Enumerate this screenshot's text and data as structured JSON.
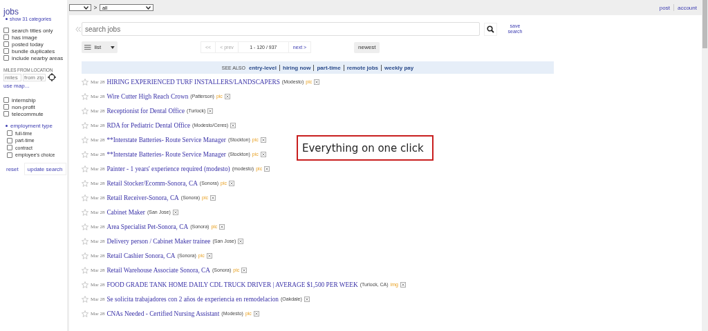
{
  "sidebar": {
    "title": "jobs",
    "show_categories": "show 31 categories",
    "filters": [
      {
        "label": "search titles only",
        "checked": false
      },
      {
        "label": "has image",
        "checked": false
      },
      {
        "label": "posted today",
        "checked": false
      },
      {
        "label": "bundle duplicates",
        "checked": false
      },
      {
        "label": "include nearby areas",
        "checked": false
      }
    ],
    "miles_label": "MILES FROM LOCATION",
    "miles_placeholder": "miles",
    "zip_placeholder": "from zip",
    "use_map": "use map...",
    "filters2": [
      {
        "label": "internship",
        "checked": false
      },
      {
        "label": "non-profit",
        "checked": false
      },
      {
        "label": "telecommute",
        "checked": false
      }
    ],
    "employment_type": {
      "label": "employment type",
      "expanded": true,
      "options": [
        {
          "label": "full-time",
          "checked": false
        },
        {
          "label": "part-time",
          "checked": false
        },
        {
          "label": "contract",
          "checked": false
        },
        {
          "label": "employee's choice",
          "checked": false
        }
      ]
    },
    "reset": "reset",
    "update_search": "update search"
  },
  "topbar": {
    "category_value": "all",
    "links": [
      "post",
      "account"
    ]
  },
  "search": {
    "placeholder": "search jobs",
    "save": "save search"
  },
  "view": "list",
  "pagination": {
    "first": "<<",
    "prev": "< prev",
    "range": "1 - 120 / 937",
    "next": "next >"
  },
  "sort": "newest",
  "see_also": {
    "label": "SEE ALSO",
    "links": [
      "entry-level",
      "hiring now",
      "part-time",
      "remote jobs",
      "weekly pay"
    ]
  },
  "listings": [
    {
      "date": "Mar 28",
      "title": "HIRING EXPERIENCED TURF INSTALLERS/LANDSCAPERS",
      "location": "(Modesto)",
      "tag": "pic"
    },
    {
      "date": "Mar 28",
      "title": "Wire Cutter High Reach Crown",
      "location": "(Patterson)",
      "tag": "pic"
    },
    {
      "date": "Mar 28",
      "title": "Receptionist for Dental Office",
      "location": "(Turlock)"
    },
    {
      "date": "Mar 28",
      "title": "RDA for Pediatric Dental Office",
      "location": "(Modesto/Ceres)"
    },
    {
      "date": "Mar 28",
      "title": "**Interstate Batteries- Route Service Manager",
      "location": "(Stockton)",
      "tag": "pic"
    },
    {
      "date": "Mar 28",
      "title": "**Interstate Batteries- Route Service Manager",
      "location": "(Stockton)",
      "tag": "pic"
    },
    {
      "date": "Mar 28",
      "title": "Painter - 1 years' experience required (modesto)",
      "location": "(modesto)",
      "tag": "pic"
    },
    {
      "date": "Mar 28",
      "title": "Retail Stocker/Ecomm-Sonora, CA",
      "location": "(Sonora)",
      "tag": "pic"
    },
    {
      "date": "Mar 28",
      "title": "Retail Receiver-Sonora, CA",
      "location": "(Sonora)",
      "tag": "pic"
    },
    {
      "date": "Mar 28",
      "title": "Cabinet Maker",
      "location": "(San Jose)"
    },
    {
      "date": "Mar 28",
      "title": "Area Specialist Pet-Sonora, CA",
      "location": "(Sonora)",
      "tag": "pic"
    },
    {
      "date": "Mar 28",
      "title": "Delivery person / Cabinet Maker trainee",
      "location": "(San Jose)"
    },
    {
      "date": "Mar 28",
      "title": "Retail Cashier Sonora, CA",
      "location": "(Sonora)",
      "tag": "pic"
    },
    {
      "date": "Mar 28",
      "title": "Retail Warehouse Associate Sonora, CA",
      "location": "(Sonora)",
      "tag": "pic"
    },
    {
      "date": "Mar 28",
      "title": "FOOD GRADE TANK HOME DAILY CDL TRUCK DRIVER | AVERAGE $1,500 PER WEEK",
      "location": "(Turlock, CA)",
      "tag": "img"
    },
    {
      "date": "Mar 28",
      "title": "Se solicita trabajadores con 2 años de experiencia en remodelacion",
      "location": "(Oakdale)"
    },
    {
      "date": "Mar 28",
      "title": "CNAs Needed - Certified Nursing Assistant",
      "location": "(Modesto)",
      "tag": "pic"
    }
  ],
  "callout": "Everything on one click"
}
